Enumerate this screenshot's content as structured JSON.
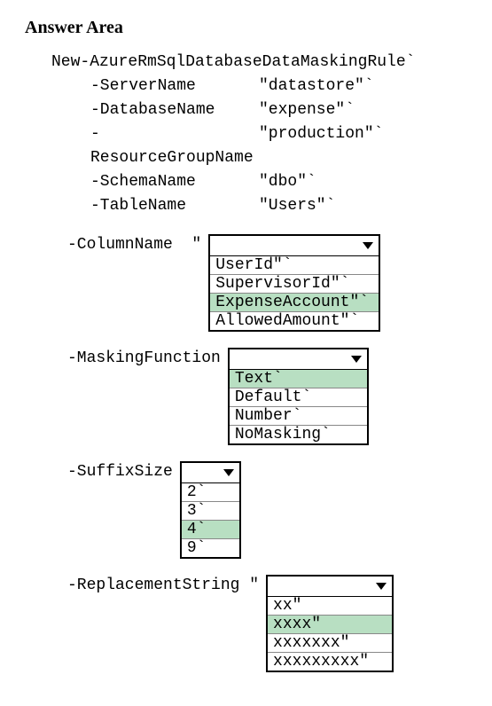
{
  "heading": "Answer Area",
  "command": "New-AzureRmSqlDatabaseDataMaskingRule`",
  "params": [
    {
      "name": "-ServerName",
      "value": "\"datastore\"`"
    },
    {
      "name": "-DatabaseName",
      "value": "\"expense\"`"
    },
    {
      "name": "-ResourceGroupName",
      "value": "\"production\"`"
    },
    {
      "name": "-SchemaName",
      "value": "\"dbo\"`"
    },
    {
      "name": "-TableName",
      "value": "\"Users\"`"
    }
  ],
  "dropdowns": {
    "column": {
      "label": "-ColumnName  \"",
      "options": [
        {
          "text": "UserId\"`",
          "selected": false
        },
        {
          "text": "SupervisorId\"`",
          "selected": false
        },
        {
          "text": "ExpenseAccount\"`",
          "selected": true
        },
        {
          "text": "AllowedAmount\"`",
          "selected": false
        }
      ]
    },
    "masking": {
      "label": "-MaskingFunction",
      "options": [
        {
          "text": "Text`",
          "selected": true
        },
        {
          "text": "Default`",
          "selected": false
        },
        {
          "text": "Number`",
          "selected": false
        },
        {
          "text": "NoMasking`",
          "selected": false
        }
      ]
    },
    "suffix": {
      "label": "-SuffixSize",
      "options": [
        {
          "text": "2`",
          "selected": false
        },
        {
          "text": "3`",
          "selected": false
        },
        {
          "text": "4`",
          "selected": true
        },
        {
          "text": "9`",
          "selected": false
        }
      ]
    },
    "replace": {
      "label": "-ReplacementString \"",
      "options": [
        {
          "text": "xx\"",
          "selected": false
        },
        {
          "text": "xxxx\"",
          "selected": true
        },
        {
          "text": "xxxxxxx\"",
          "selected": false
        },
        {
          "text": "xxxxxxxxx\"",
          "selected": false
        }
      ]
    }
  }
}
